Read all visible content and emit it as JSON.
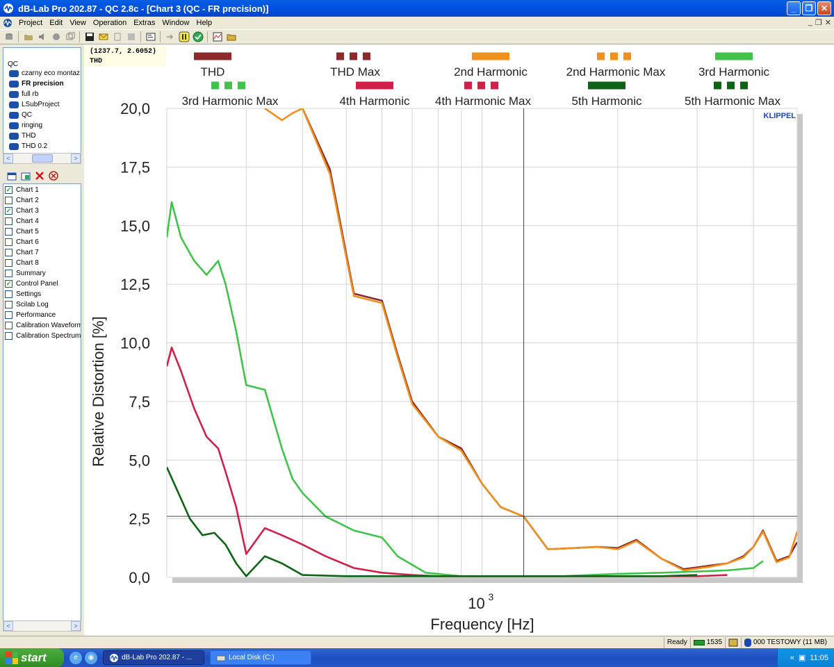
{
  "window": {
    "title": "dB-Lab Pro 202.87 - QC 2.8c - [Chart 3 (QC - FR precision)]",
    "min_glyph": "_",
    "max_glyph": "❐",
    "close_glyph": "✕"
  },
  "menubar": {
    "items": [
      "Project",
      "Edit",
      "View",
      "Operation",
      "Extras",
      "Window",
      "Help"
    ],
    "mdi_min": "_",
    "mdi_restore": "❐",
    "mdi_close": "✕"
  },
  "toolbar": {
    "icons": [
      "db-icon",
      "open-folder-icon",
      "speaker-icon",
      "run-icon",
      "copy-icon",
      "save-icon",
      "mail-icon",
      "import-icon",
      "export-icon",
      "properties-icon",
      "arrow-icon",
      "pause-icon",
      "check-icon",
      "chart-icon",
      "folder-icon"
    ]
  },
  "tree": {
    "root_label": "QC",
    "items": [
      {
        "label": "czarny eco montaz",
        "selected": false
      },
      {
        "label": "FR precision",
        "selected": true
      },
      {
        "label": "full rb",
        "selected": false
      },
      {
        "label": "LSubProject",
        "selected": false
      },
      {
        "label": "QC",
        "selected": false
      },
      {
        "label": "ringing",
        "selected": false
      },
      {
        "label": "THD",
        "selected": false
      },
      {
        "label": "THD 0.2",
        "selected": false
      }
    ],
    "scroll_left": "<",
    "scroll_right": ">"
  },
  "chart_list": {
    "items": [
      {
        "label": "Chart 1",
        "checked": true
      },
      {
        "label": "Chart 2",
        "checked": false
      },
      {
        "label": "Chart 3",
        "checked": true
      },
      {
        "label": "Chart 4",
        "checked": false
      },
      {
        "label": "Chart 5",
        "checked": false
      },
      {
        "label": "Chart 6",
        "checked": false
      },
      {
        "label": "Chart 7",
        "checked": false
      },
      {
        "label": "Chart 8",
        "checked": false
      },
      {
        "label": "Summary",
        "checked": false
      },
      {
        "label": "Control Panel",
        "checked": true
      },
      {
        "label": "Settings",
        "checked": false
      },
      {
        "label": "Scilab Log",
        "checked": false
      },
      {
        "label": "Performance",
        "checked": false
      },
      {
        "label": "Calibration Waveform",
        "checked": false
      },
      {
        "label": "Calibration Spectrum",
        "checked": false
      }
    ],
    "check_glyph": "✓"
  },
  "cursor_readout": {
    "coords": "(1237.7, 2.6052)",
    "label": "THD"
  },
  "brand": "KLIPPEL",
  "chart_data": {
    "type": "line",
    "xlabel": "Frequency  [Hz]",
    "ylabel": "Relative Distortion  [%]",
    "x_tick_label": "10",
    "x_tick_exp": "3",
    "x_scale": "log",
    "xlim": [
      200,
      5000
    ],
    "ylim": [
      0,
      20
    ],
    "y_ticks": [
      "0,0",
      "2,5",
      "5,0",
      "7,5",
      "10,0",
      "12,5",
      "15,0",
      "17,5",
      "20,0"
    ],
    "y_tick_values": [
      0,
      2.5,
      5,
      7.5,
      10,
      12.5,
      15,
      17.5,
      20
    ],
    "grid": true,
    "legend_position": "top",
    "cursor": {
      "x": 1237.7,
      "y": 2.6052
    },
    "series": [
      {
        "name": "THD",
        "color": "#8b2a2a",
        "dash": false,
        "x": [
          400,
          460,
          520,
          600,
          650,
          700,
          800,
          900,
          1000,
          1100,
          1237,
          1400,
          1600,
          1800,
          2000,
          2200,
          2500,
          2800,
          3200,
          3500,
          3800,
          4000,
          4200,
          4500,
          4800,
          5000
        ],
        "y": [
          20,
          17.4,
          12.1,
          11.8,
          9.5,
          7.5,
          6.0,
          5.5,
          4.0,
          3.0,
          2.6,
          1.2,
          1.25,
          1.3,
          1.25,
          1.6,
          0.8,
          0.35,
          0.5,
          0.6,
          0.9,
          1.3,
          2.0,
          0.7,
          0.9,
          1.5
        ]
      },
      {
        "name": "THD Max",
        "color": "#8b2a2a",
        "dash": true,
        "x": [],
        "y": []
      },
      {
        "name": "2nd Harmonic",
        "color": "#f0901e",
        "dash": false,
        "x": [
          330,
          360,
          380,
          400,
          460,
          520,
          600,
          650,
          700,
          800,
          900,
          1000,
          1100,
          1237,
          1400,
          1600,
          1800,
          2000,
          2200,
          2500,
          2800,
          3200,
          3500,
          3800,
          4000,
          4200,
          4500,
          4800,
          5000
        ],
        "y": [
          20,
          19.5,
          19.8,
          20,
          17.2,
          12.0,
          11.7,
          9.4,
          7.4,
          6.0,
          5.4,
          4.0,
          3.0,
          2.6,
          1.2,
          1.25,
          1.3,
          1.2,
          1.55,
          0.8,
          0.3,
          0.45,
          0.6,
          0.85,
          1.3,
          1.95,
          0.65,
          0.85,
          1.95
        ]
      },
      {
        "name": "2nd Harmonic Max",
        "color": "#f0901e",
        "dash": true,
        "x": [],
        "y": []
      },
      {
        "name": "3rd Harmonic",
        "color": "#3fc34a",
        "dash": false,
        "x": [
          200,
          205,
          215,
          230,
          245,
          260,
          270,
          285,
          300,
          330,
          360,
          380,
          400,
          450,
          520,
          600,
          650,
          750,
          900,
          1100,
          1500,
          2000,
          2500,
          3000,
          3500,
          4000,
          4200
        ],
        "y": [
          14.5,
          16.0,
          14.5,
          13.5,
          12.9,
          13.5,
          12.5,
          10.5,
          8.2,
          8.0,
          5.5,
          4.2,
          3.6,
          2.6,
          2.0,
          1.7,
          0.9,
          0.2,
          0.05,
          0.05,
          0.05,
          0.15,
          0.2,
          0.25,
          0.3,
          0.4,
          0.7
        ]
      },
      {
        "name": "3rd Harmonic Max",
        "color": "#3fc34a",
        "dash": true,
        "x": [],
        "y": []
      },
      {
        "name": "4th Harmonic",
        "color": "#d0204a",
        "dash": false,
        "x": [
          200,
          205,
          215,
          230,
          245,
          260,
          270,
          285,
          300,
          330,
          360,
          400,
          450,
          520,
          600,
          700,
          800,
          1000,
          1500,
          2000,
          2500,
          3000,
          3500
        ],
        "y": [
          9.0,
          9.8,
          8.8,
          7.2,
          6.0,
          5.5,
          4.5,
          3.0,
          1.0,
          2.1,
          1.8,
          1.4,
          0.9,
          0.4,
          0.2,
          0.1,
          0.05,
          0.05,
          0.05,
          0.05,
          0.05,
          0.05,
          0.1
        ]
      },
      {
        "name": "4th Harmonic Max",
        "color": "#d0204a",
        "dash": true,
        "x": [],
        "y": []
      },
      {
        "name": "5th Harmonic",
        "color": "#0d6414",
        "dash": false,
        "x": [
          200,
          210,
          225,
          240,
          255,
          270,
          285,
          300,
          330,
          360,
          400,
          500,
          700,
          1000,
          1500,
          2000,
          2500,
          3000
        ],
        "y": [
          4.7,
          3.8,
          2.5,
          1.8,
          1.9,
          1.4,
          0.6,
          0.05,
          0.9,
          0.6,
          0.1,
          0.05,
          0.05,
          0.05,
          0.05,
          0.05,
          0.05,
          0.1
        ]
      },
      {
        "name": "5th Harmonic Max",
        "color": "#0d6414",
        "dash": true,
        "x": [],
        "y": []
      }
    ]
  },
  "statusbar": {
    "status": "Ready",
    "counter": "1535",
    "db_label": "000 TESTOWY (11 MB)"
  },
  "taskbar": {
    "start_label": "start",
    "tasks": [
      {
        "label": "dB-Lab Pro 202.87 - ...",
        "active": true
      },
      {
        "label": "Local Disk (C:)",
        "active": false
      }
    ],
    "clock": "11:05"
  }
}
